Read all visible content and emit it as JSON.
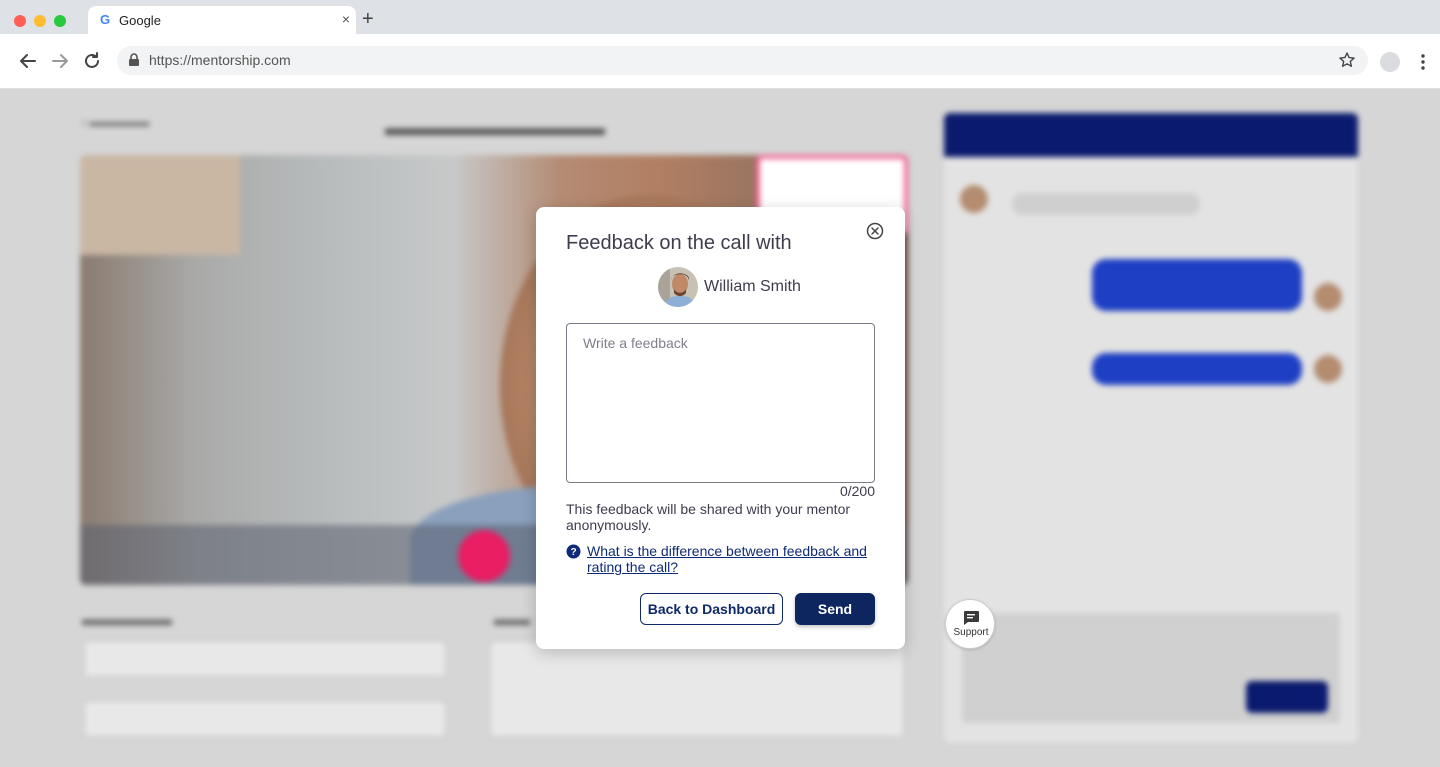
{
  "browser": {
    "tab_title": "Google",
    "tab_favicon": "G",
    "tab_close": "×",
    "new_tab": "+",
    "url": "https://mentorship.com",
    "icons": [
      "back-arrow-icon",
      "forward-arrow-icon",
      "reload-icon",
      "lock-icon",
      "star-icon",
      "profile-icon",
      "kebab-menu-icon"
    ]
  },
  "modal": {
    "title": "Feedback on the call with",
    "mentor_name": "William Smith",
    "feedback_placeholder": "Write a feedback",
    "feedback_value": "",
    "counter": "0/200",
    "note": "This feedback will be shared with your mentor anonymously.",
    "help_link": "What is the difference between feedback and rating the call?",
    "back_button": "Back to Dashboard",
    "send_button": "Send"
  },
  "support": {
    "label": "Support"
  },
  "colors": {
    "primary_navy": "#0d2660",
    "end_call_pink": "#e91e63",
    "chat_blue": "#1e3fc4",
    "overlay_gray": "#d6d6d6"
  }
}
